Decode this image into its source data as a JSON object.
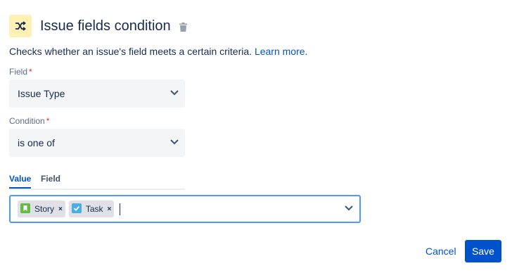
{
  "header": {
    "title": "Issue fields condition",
    "icon": "shuffle-icon",
    "accent_color": "#fff0b3"
  },
  "description": {
    "text": "Checks whether an issue's field meets a certain criteria.",
    "link": "Learn more."
  },
  "field": {
    "label": "Field",
    "required_mark": "*",
    "value": "Issue Type"
  },
  "condition": {
    "label": "Condition",
    "required_mark": "*",
    "value": "is one of"
  },
  "tabs": [
    {
      "label": "Value",
      "active": true
    },
    {
      "label": "Field",
      "active": false
    }
  ],
  "values": [
    {
      "label": "Story",
      "icon": "story-icon",
      "color": "#65ba43",
      "remove": "×"
    },
    {
      "label": "Task",
      "icon": "task-icon",
      "color": "#4bade8",
      "remove": "×"
    }
  ],
  "footer": {
    "cancel": "Cancel",
    "save": "Save"
  }
}
